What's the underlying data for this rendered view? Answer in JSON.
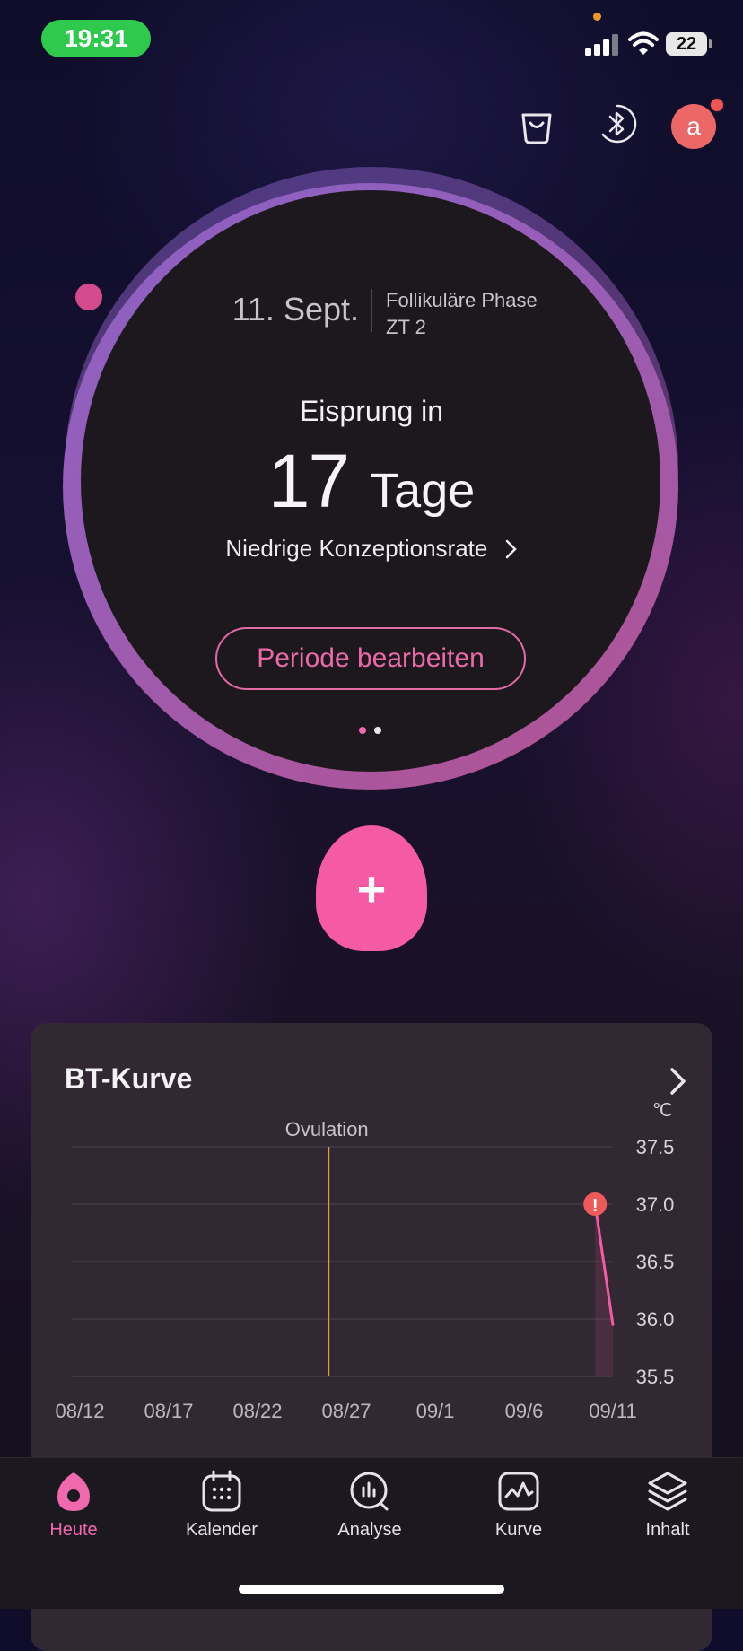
{
  "status_bar": {
    "time": "19:31",
    "battery": "22"
  },
  "top_bar": {
    "avatar_initial": "a"
  },
  "cycle": {
    "date": "11. Sept.",
    "phase": "Follikuläre Phase",
    "cycle_day": "ZT 2",
    "headline": "Eisprung in",
    "count": "17",
    "count_unit": "Tage",
    "conception_rate": "Niedrige Konzeptionsrate",
    "edit_period_label": "Periode bearbeiten",
    "pager_active": 0,
    "pager_count": 2
  },
  "add_button": {
    "symbol": "+"
  },
  "bt_card": {
    "title": "BT-Kurve",
    "unit": "℃",
    "ovulation_label": "Ovulation"
  },
  "chart_data": {
    "type": "line",
    "title": "BT-Kurve",
    "ylabel": "℃",
    "ylim": [
      35.5,
      37.5
    ],
    "y_ticks": [
      "37.5",
      "37.0",
      "36.5",
      "36.0",
      "35.5"
    ],
    "x_ticks": [
      "08/12",
      "08/17",
      "08/22",
      "08/27",
      "09/1",
      "09/6",
      "09/11"
    ],
    "annotations": [
      {
        "type": "vertical-line",
        "x": "08/26",
        "label": "Ovulation"
      }
    ],
    "series": [
      {
        "points": [
          {
            "x": "09/10",
            "y": 37.0,
            "flag": "!"
          },
          {
            "x": "09/11",
            "y": 35.95
          }
        ]
      }
    ]
  },
  "tabs": [
    {
      "label": "Heute",
      "icon": "drop-icon",
      "active": true
    },
    {
      "label": "Kalender",
      "icon": "calendar-icon",
      "active": false
    },
    {
      "label": "Analyse",
      "icon": "analysis-icon",
      "active": false
    },
    {
      "label": "Kurve",
      "icon": "curve-icon",
      "active": false
    },
    {
      "label": "Inhalt",
      "icon": "layers-icon",
      "active": false
    }
  ],
  "colors": {
    "accent_pink": "#f55aa5",
    "status_green": "#2fc94d",
    "ovulation_line": "#d9a33a",
    "tab_active": "#f068ad",
    "tab_inactive": "#e6e2e8"
  }
}
